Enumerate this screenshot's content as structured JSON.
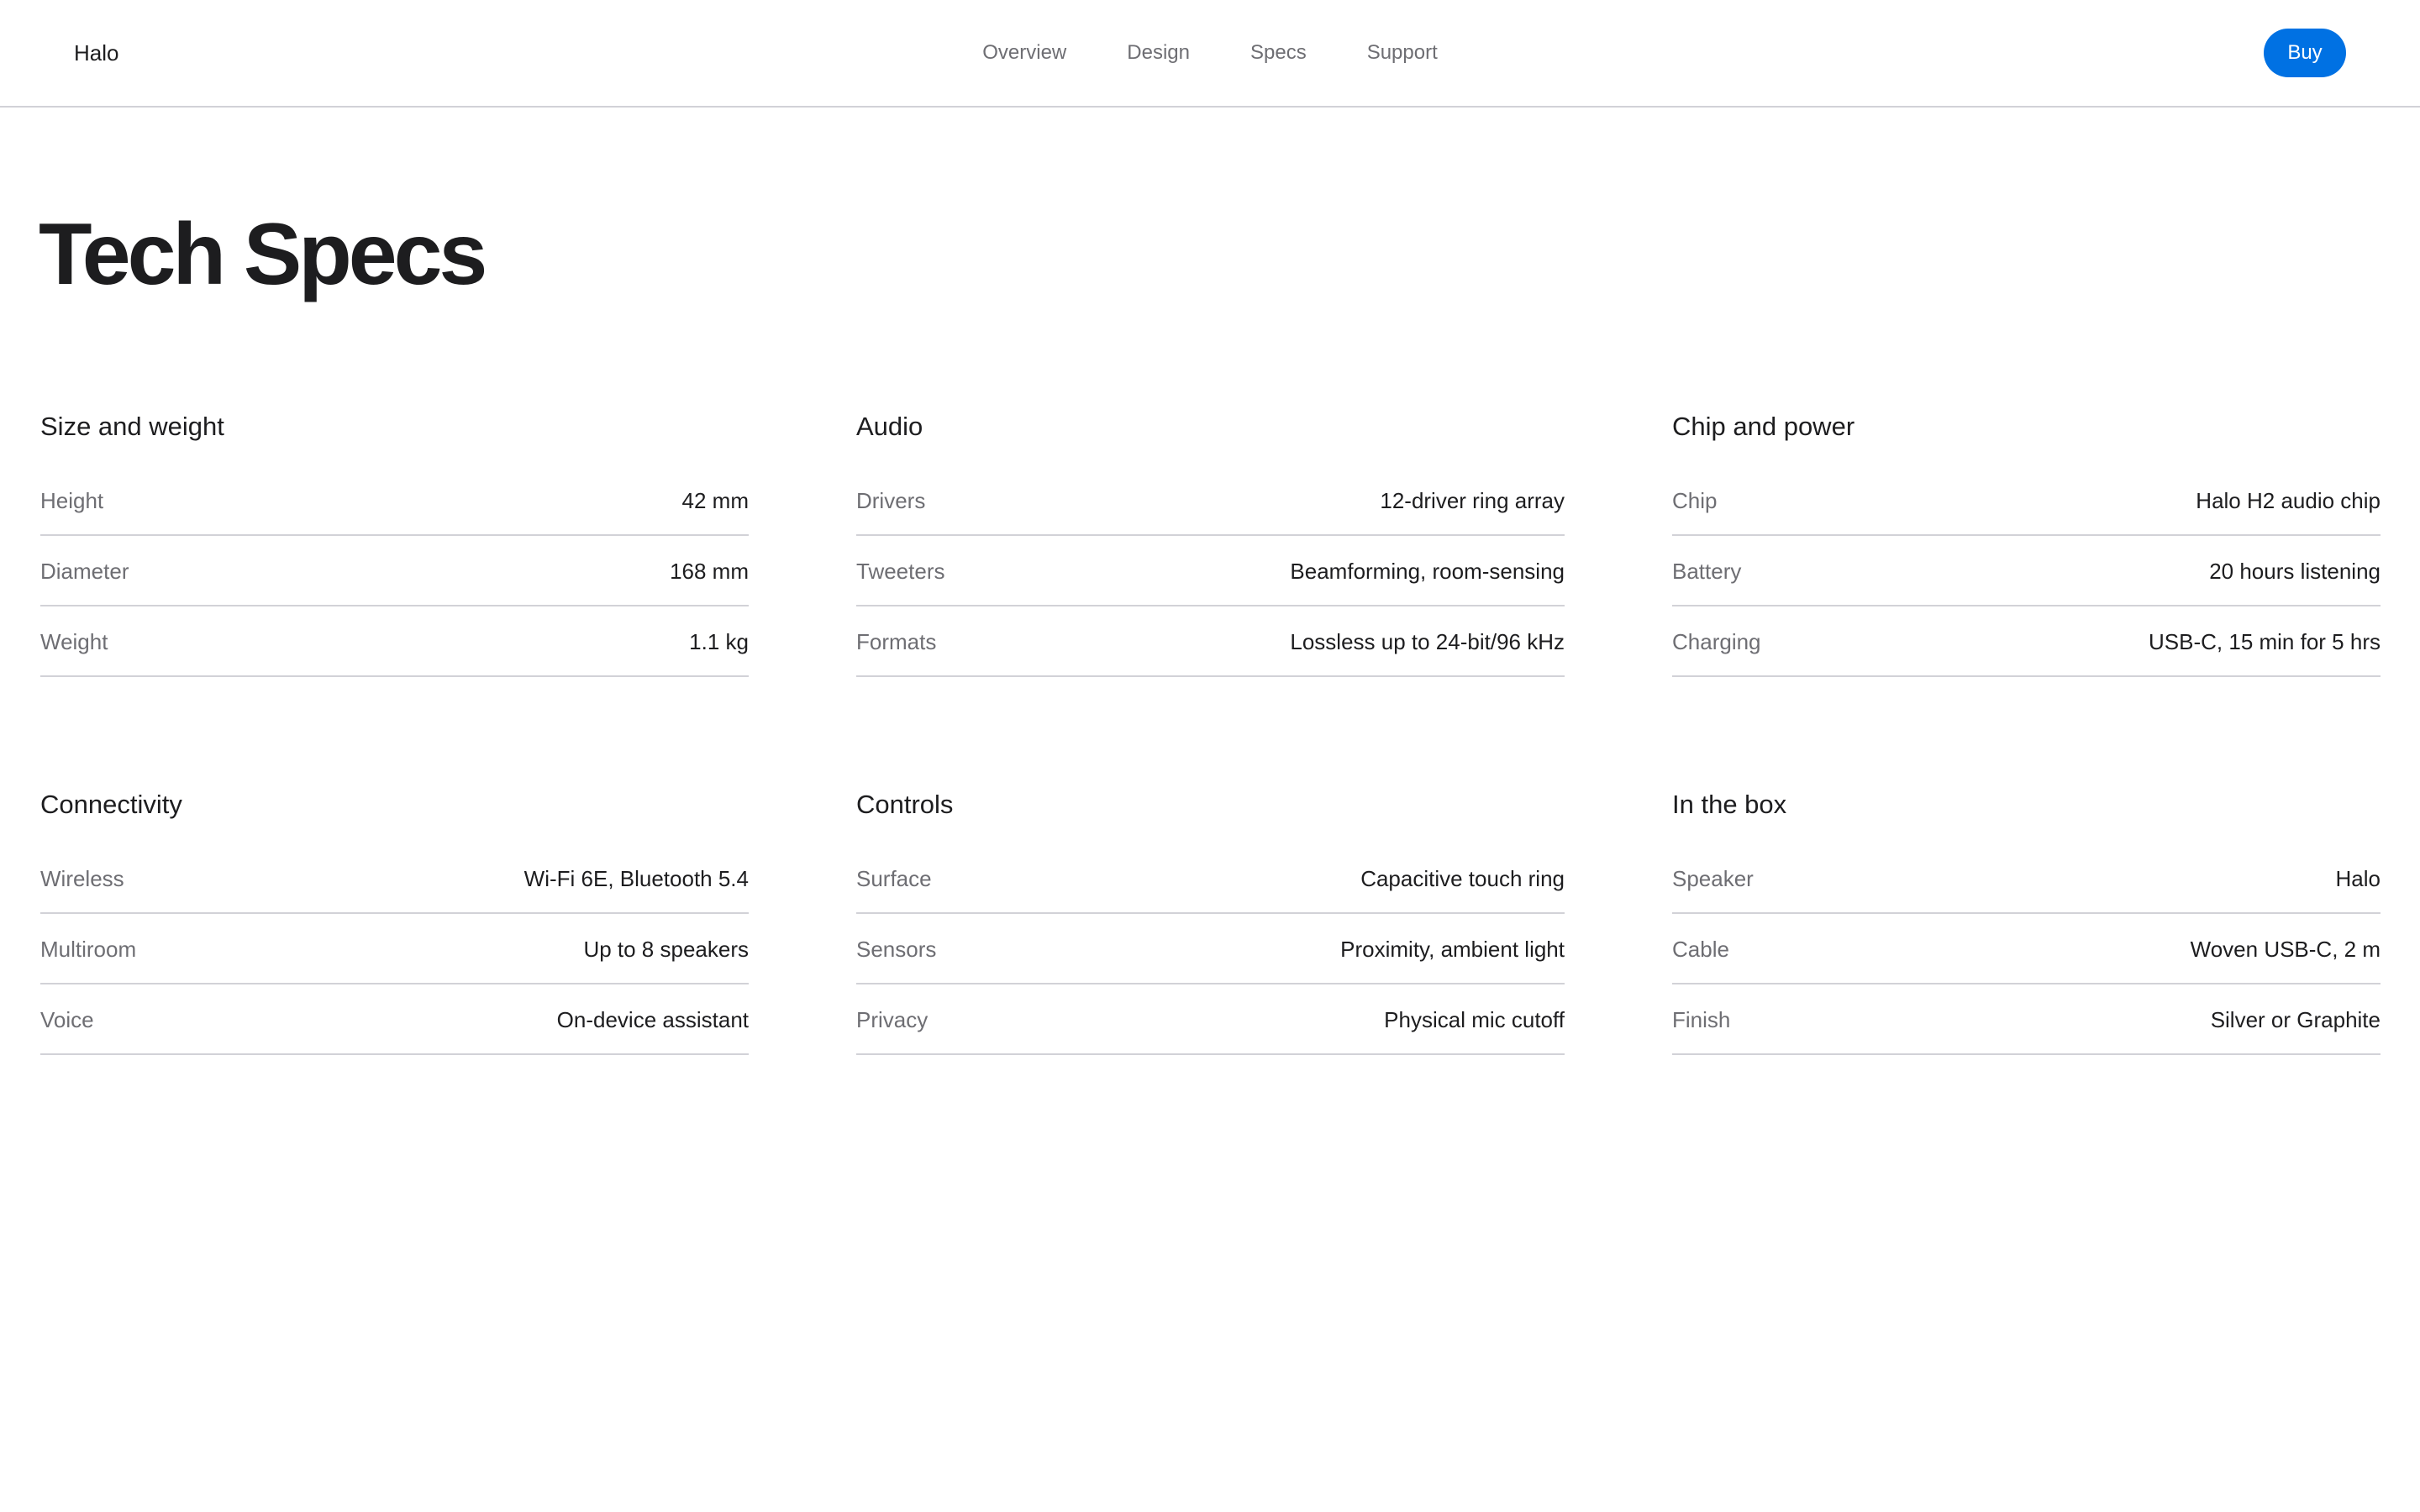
{
  "header": {
    "brand": "Halo",
    "nav": [
      "Overview",
      "Design",
      "Specs",
      "Support"
    ],
    "buy_label": "Buy"
  },
  "page_title": "Tech Specs",
  "groups": [
    {
      "title": "Size and weight",
      "rows": [
        {
          "label": "Height",
          "value": "42 mm"
        },
        {
          "label": "Diameter",
          "value": "168 mm"
        },
        {
          "label": "Weight",
          "value": "1.1 kg"
        }
      ]
    },
    {
      "title": "Audio",
      "rows": [
        {
          "label": "Drivers",
          "value": "12-driver ring array"
        },
        {
          "label": "Tweeters",
          "value": "Beamforming, room-sensing"
        },
        {
          "label": "Formats",
          "value": "Lossless up to 24-bit/96 kHz"
        }
      ]
    },
    {
      "title": "Chip and power",
      "rows": [
        {
          "label": "Chip",
          "value": "Halo H2 audio chip"
        },
        {
          "label": "Battery",
          "value": "20 hours listening"
        },
        {
          "label": "Charging",
          "value": "USB-C, 15 min for 5 hrs"
        }
      ]
    },
    {
      "title": "Connectivity",
      "rows": [
        {
          "label": "Wireless",
          "value": "Wi-Fi 6E, Bluetooth 5.4"
        },
        {
          "label": "Multiroom",
          "value": "Up to 8 speakers"
        },
        {
          "label": "Voice",
          "value": "On-device assistant"
        }
      ]
    },
    {
      "title": "Controls",
      "rows": [
        {
          "label": "Surface",
          "value": "Capacitive touch ring"
        },
        {
          "label": "Sensors",
          "value": "Proximity, ambient light"
        },
        {
          "label": "Privacy",
          "value": "Physical mic cutoff"
        }
      ]
    },
    {
      "title": "In the box",
      "rows": [
        {
          "label": "Speaker",
          "value": "Halo"
        },
        {
          "label": "Cable",
          "value": "Woven USB-C, 2 m"
        },
        {
          "label": "Finish",
          "value": "Silver or Graphite"
        }
      ]
    }
  ],
  "colors": {
    "accent": "#0071e3",
    "text_primary": "#1d1d1f",
    "text_secondary": "#6e6e73",
    "divider": "#d2d2d7"
  }
}
